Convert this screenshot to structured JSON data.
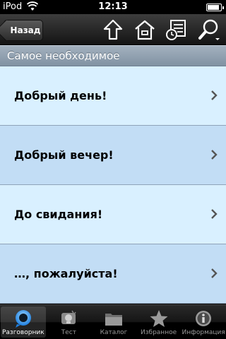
{
  "status": {
    "carrier": "iPod",
    "time": "12:13",
    "battery_level": 0.9
  },
  "nav": {
    "back_label": "Назад",
    "icons": [
      "up-arrow-icon",
      "home-icon",
      "history-list-icon",
      "search-icon"
    ]
  },
  "section": {
    "title": "Самое необходимое"
  },
  "items": [
    {
      "label": "Добрый день!"
    },
    {
      "label": "Добрый вечер!"
    },
    {
      "label": "До свидания!"
    },
    {
      "label": "…, пожалуйста!"
    }
  ],
  "tabs": [
    {
      "label": "Разговорник",
      "icon": "chat-bubble-icon",
      "active": true
    },
    {
      "label": "Тест",
      "icon": "lightbulb-icon",
      "active": false
    },
    {
      "label": "Каталог",
      "icon": "folder-icon",
      "active": false
    },
    {
      "label": "Избранное",
      "icon": "star-icon",
      "active": false
    },
    {
      "label": "Информация",
      "icon": "info-icon",
      "active": false
    }
  ],
  "colors": {
    "accent": "#1e90ff",
    "row_light": "#d9f0ff",
    "row_dark": "#c2ddf5"
  }
}
